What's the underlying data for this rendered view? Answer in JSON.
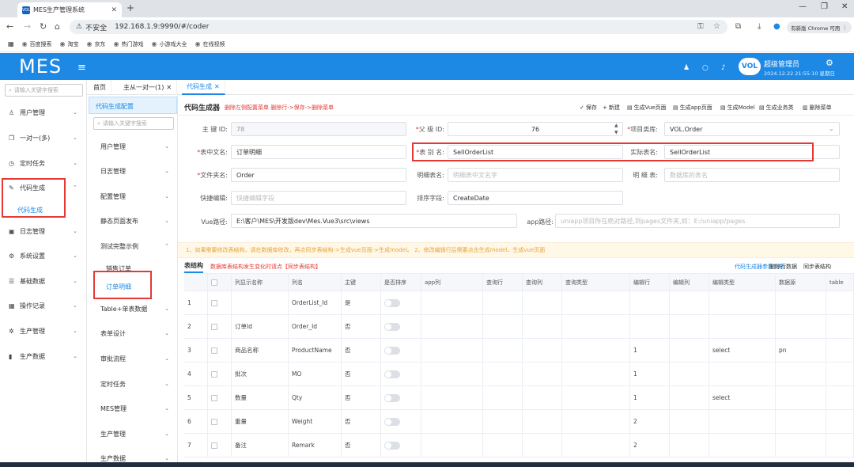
{
  "browser": {
    "tab_title": "MES生产管理系统",
    "tab_favicon": "VOL",
    "insecure_label": "不安全",
    "url": "192.168.1.9:9990/#/coder",
    "profile_label": "有新版 Chrome 可用",
    "bookmarks": [
      "百度搜索",
      "淘宝",
      "京东",
      "热门游戏",
      "小游戏大全",
      "在线视频"
    ]
  },
  "header": {
    "logo": "MES",
    "avatar_text": "VOL",
    "user_name": "超级管理员",
    "user_datetime": "2024.12.22 21:55:10 星期日"
  },
  "left_sidebar": {
    "search_placeholder": "请输入关键字搜索",
    "items": [
      "用户管理",
      "一对一(多)",
      "定时任务",
      "代码生成",
      "日志管理",
      "系统设置",
      "基础数据",
      "操作记录",
      "生产管理",
      "生产数据"
    ],
    "active_sub": "代码生成"
  },
  "page_tabs": [
    "首页",
    "主从一对一(1)",
    "代码生成"
  ],
  "menu_column": {
    "title": "代码生成配置",
    "search_placeholder": "请输入关键字搜索",
    "items": [
      "用户管理",
      "日志管理",
      "配置管理",
      "静态页面发布",
      "测试完整示例",
      "Table+单表数据",
      "表单设计",
      "审批流程",
      "定时任务",
      "MES管理",
      "生产管理",
      "生产数据"
    ],
    "sub_items": [
      "销售订单",
      "订单明细"
    ]
  },
  "generator": {
    "title": "代码生成器",
    "hint": "删除左侧配置菜单 删除行->保存->删除菜单",
    "toolbar": [
      "保存",
      "新建",
      "生成Vue页面",
      "生成app页面",
      "生成Model",
      "生成业务类",
      "删除菜单"
    ],
    "fields": {
      "primary_id_label": "主 键 ID:",
      "primary_id_value": "78",
      "parent_id_label": "父 级 ID:",
      "parent_id_value": "76",
      "project_label": "项目类库:",
      "project_value": "VOL.Order",
      "cn_name_label": "表中文名:",
      "cn_name_value": "订单明细",
      "alias_label": "表 别 名:",
      "alias_value": "SellOrderList",
      "real_name_label": "实际表名:",
      "real_name_value": "SellOrderList",
      "folder_label": "文件夹名:",
      "folder_value": "Order",
      "detail_cn_label": "明细表名:",
      "detail_cn_placeholder": "明细表中文名字",
      "detail_table_label": "明 细 表:",
      "detail_table_placeholder": "数据库的表名",
      "quick_edit_label": "快捷编辑:",
      "quick_edit_placeholder": "快捷编辑字段",
      "sort_label": "排序字段:",
      "sort_value": "CreateDate",
      "vue_path_label": "Vue路径:",
      "vue_path_value": "E:\\客户\\MES\\开发版dev\\Mes.Vue3\\src\\views",
      "app_path_label": "app路径:",
      "app_path_placeholder": "uniapp项目所在绝对路径,到pages文件夹,如：E:/uniapp/pages"
    },
    "warning": "1、如果需要修改表结构，请在数据库修改，再点同步表结构->生成vue页面->生成model。 2、修改编辑行后需要点击生成model、生成vue页面",
    "table_tab": "表结构",
    "table_hint": "数据库表结构发生变化时请点【同步表结构】",
    "table_links": [
      "代码生成器参数文档",
      "删除行数据",
      "同步表结构"
    ]
  },
  "grid": {
    "columns": [
      "",
      "",
      "列显示名称",
      "列名",
      "主键",
      "是否排序",
      "app列",
      "查询行",
      "查询列",
      "查询类型",
      "编辑行",
      "编辑列",
      "编辑类型",
      "数据源",
      "table"
    ],
    "rows": [
      [
        "1",
        "",
        "OrderList_Id",
        "是",
        "",
        "",
        "",
        "",
        "",
        "",
        "",
        "",
        ""
      ],
      [
        "2",
        "订单Id",
        "Order_Id",
        "否",
        "",
        "",
        "",
        "",
        "",
        "",
        "",
        "",
        ""
      ],
      [
        "3",
        "商品名称",
        "ProductName",
        "否",
        "",
        "",
        "",
        "",
        "1",
        "",
        "select",
        "pn",
        ""
      ],
      [
        "4",
        "批次",
        "MO",
        "否",
        "",
        "",
        "",
        "",
        "1",
        "",
        "",
        "",
        ""
      ],
      [
        "5",
        "数量",
        "Qty",
        "否",
        "",
        "",
        "",
        "",
        "1",
        "",
        "select",
        "",
        ""
      ],
      [
        "6",
        "重量",
        "Weight",
        "否",
        "",
        "",
        "",
        "",
        "2",
        "",
        "",
        "",
        ""
      ],
      [
        "7",
        "备注",
        "Remark",
        "否",
        "",
        "",
        "",
        "",
        "2",
        "",
        "",
        "",
        ""
      ]
    ]
  }
}
